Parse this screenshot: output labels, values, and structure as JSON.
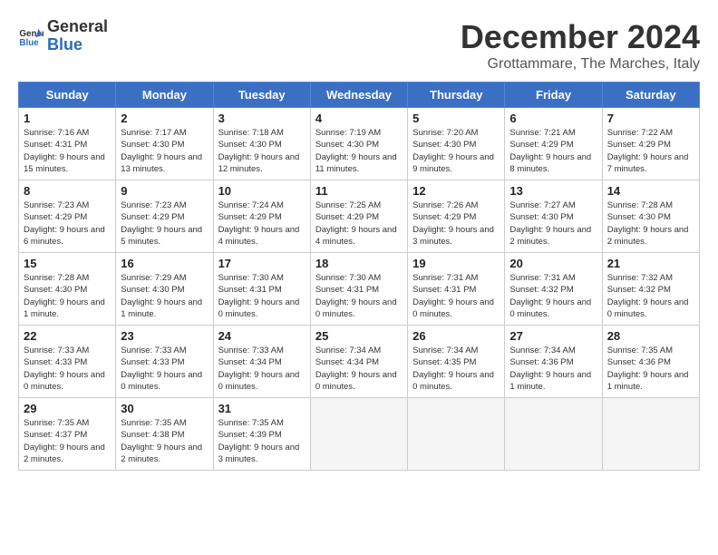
{
  "header": {
    "logo_line1": "General",
    "logo_line2": "Blue",
    "month": "December 2024",
    "location": "Grottammare, The Marches, Italy"
  },
  "weekdays": [
    "Sunday",
    "Monday",
    "Tuesday",
    "Wednesday",
    "Thursday",
    "Friday",
    "Saturday"
  ],
  "weeks": [
    [
      {
        "day": 1,
        "rise": "7:16 AM",
        "set": "4:31 PM",
        "daylight": "9 hours and 15 minutes."
      },
      {
        "day": 2,
        "rise": "7:17 AM",
        "set": "4:30 PM",
        "daylight": "9 hours and 13 minutes."
      },
      {
        "day": 3,
        "rise": "7:18 AM",
        "set": "4:30 PM",
        "daylight": "9 hours and 12 minutes."
      },
      {
        "day": 4,
        "rise": "7:19 AM",
        "set": "4:30 PM",
        "daylight": "9 hours and 11 minutes."
      },
      {
        "day": 5,
        "rise": "7:20 AM",
        "set": "4:30 PM",
        "daylight": "9 hours and 9 minutes."
      },
      {
        "day": 6,
        "rise": "7:21 AM",
        "set": "4:29 PM",
        "daylight": "9 hours and 8 minutes."
      },
      {
        "day": 7,
        "rise": "7:22 AM",
        "set": "4:29 PM",
        "daylight": "9 hours and 7 minutes."
      }
    ],
    [
      {
        "day": 8,
        "rise": "7:23 AM",
        "set": "4:29 PM",
        "daylight": "9 hours and 6 minutes."
      },
      {
        "day": 9,
        "rise": "7:23 AM",
        "set": "4:29 PM",
        "daylight": "9 hours and 5 minutes."
      },
      {
        "day": 10,
        "rise": "7:24 AM",
        "set": "4:29 PM",
        "daylight": "9 hours and 4 minutes."
      },
      {
        "day": 11,
        "rise": "7:25 AM",
        "set": "4:29 PM",
        "daylight": "9 hours and 4 minutes."
      },
      {
        "day": 12,
        "rise": "7:26 AM",
        "set": "4:29 PM",
        "daylight": "9 hours and 3 minutes."
      },
      {
        "day": 13,
        "rise": "7:27 AM",
        "set": "4:30 PM",
        "daylight": "9 hours and 2 minutes."
      },
      {
        "day": 14,
        "rise": "7:28 AM",
        "set": "4:30 PM",
        "daylight": "9 hours and 2 minutes."
      }
    ],
    [
      {
        "day": 15,
        "rise": "7:28 AM",
        "set": "4:30 PM",
        "daylight": "9 hours and 1 minute."
      },
      {
        "day": 16,
        "rise": "7:29 AM",
        "set": "4:30 PM",
        "daylight": "9 hours and 1 minute."
      },
      {
        "day": 17,
        "rise": "7:30 AM",
        "set": "4:31 PM",
        "daylight": "9 hours and 0 minutes."
      },
      {
        "day": 18,
        "rise": "7:30 AM",
        "set": "4:31 PM",
        "daylight": "9 hours and 0 minutes."
      },
      {
        "day": 19,
        "rise": "7:31 AM",
        "set": "4:31 PM",
        "daylight": "9 hours and 0 minutes."
      },
      {
        "day": 20,
        "rise": "7:31 AM",
        "set": "4:32 PM",
        "daylight": "9 hours and 0 minutes."
      },
      {
        "day": 21,
        "rise": "7:32 AM",
        "set": "4:32 PM",
        "daylight": "9 hours and 0 minutes."
      }
    ],
    [
      {
        "day": 22,
        "rise": "7:33 AM",
        "set": "4:33 PM",
        "daylight": "9 hours and 0 minutes."
      },
      {
        "day": 23,
        "rise": "7:33 AM",
        "set": "4:33 PM",
        "daylight": "9 hours and 0 minutes."
      },
      {
        "day": 24,
        "rise": "7:33 AM",
        "set": "4:34 PM",
        "daylight": "9 hours and 0 minutes."
      },
      {
        "day": 25,
        "rise": "7:34 AM",
        "set": "4:34 PM",
        "daylight": "9 hours and 0 minutes."
      },
      {
        "day": 26,
        "rise": "7:34 AM",
        "set": "4:35 PM",
        "daylight": "9 hours and 0 minutes."
      },
      {
        "day": 27,
        "rise": "7:34 AM",
        "set": "4:36 PM",
        "daylight": "9 hours and 1 minute."
      },
      {
        "day": 28,
        "rise": "7:35 AM",
        "set": "4:36 PM",
        "daylight": "9 hours and 1 minute."
      }
    ],
    [
      {
        "day": 29,
        "rise": "7:35 AM",
        "set": "4:37 PM",
        "daylight": "9 hours and 2 minutes."
      },
      {
        "day": 30,
        "rise": "7:35 AM",
        "set": "4:38 PM",
        "daylight": "9 hours and 2 minutes."
      },
      {
        "day": 31,
        "rise": "7:35 AM",
        "set": "4:39 PM",
        "daylight": "9 hours and 3 minutes."
      },
      null,
      null,
      null,
      null
    ]
  ]
}
